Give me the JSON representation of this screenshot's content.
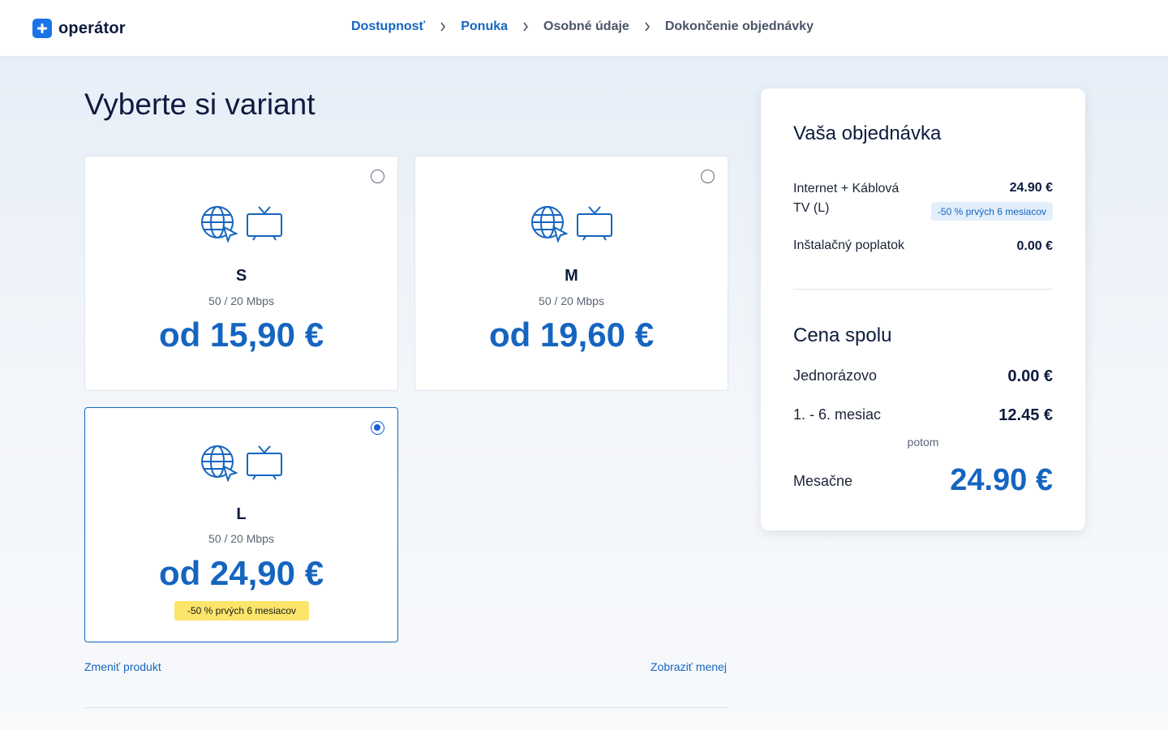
{
  "header": {
    "logo_text": "operátor",
    "steps": [
      {
        "label": "Dostupnosť",
        "active": true
      },
      {
        "label": "Ponuka",
        "active": true
      },
      {
        "label": "Osobné údaje",
        "active": false
      },
      {
        "label": "Dokončenie objednávky",
        "active": false
      }
    ]
  },
  "main": {
    "title": "Vyberte si variant",
    "plans": [
      {
        "name": "S",
        "speed": "50 / 20 Mbps",
        "price": "od 15,90 €",
        "selected": false,
        "promo": ""
      },
      {
        "name": "M",
        "speed": "50 / 20 Mbps",
        "price": "od 19,60 €",
        "selected": false,
        "promo": ""
      },
      {
        "name": "L",
        "speed": "50 / 20 Mbps",
        "price": "od 24,90 €",
        "selected": true,
        "promo": "-50 % prvých 6 mesiacov"
      }
    ],
    "change_product_link": "Zmeniť produkt",
    "show_less_link": "Zobraziť menej"
  },
  "summary": {
    "title": "Vaša objednávka",
    "item_label": "Internet + Káblová TV (L)",
    "item_price": "24.90 €",
    "item_promo": "-50 % prvých 6 mesiacov",
    "fee_label": "Inštalačný poplatok",
    "fee_price": "0.00 €",
    "total_title": "Cena spolu",
    "one_time_label": "Jednorázovo",
    "one_time_value": "0.00 €",
    "first_months_label": "1. - 6. mesiac",
    "first_months_value": "12.45 €",
    "then_label": "potom",
    "monthly_label": "Mesačne",
    "monthly_value": "24.90 €"
  },
  "colors": {
    "accent": "#1565c0",
    "promo_yellow": "#fbe56b",
    "promo_blue_bg": "#e3eefb"
  }
}
